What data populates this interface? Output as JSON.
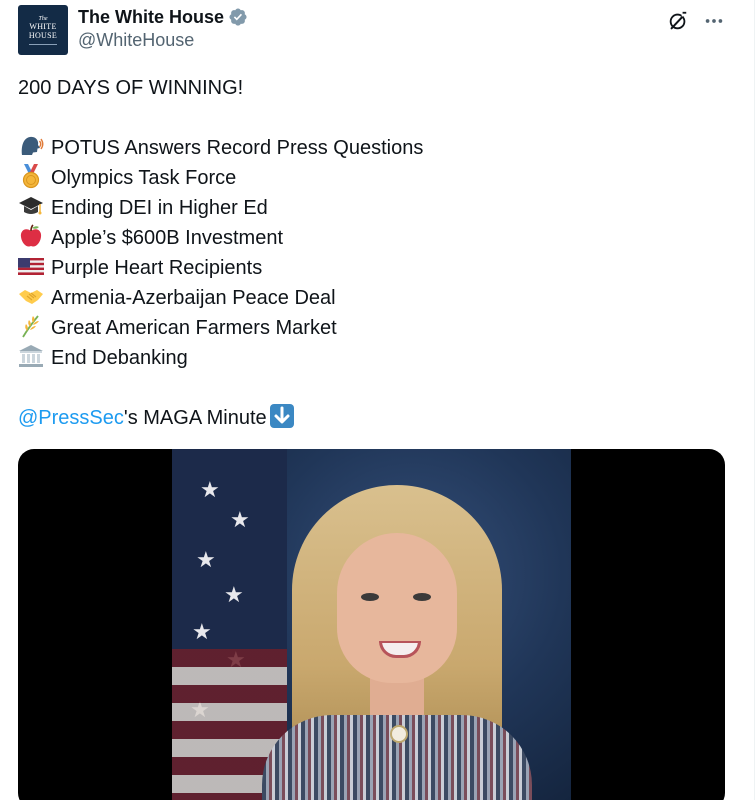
{
  "author": {
    "display_name": "The White House",
    "handle": "@WhiteHouse",
    "avatar": {
      "line1": "The",
      "line2": "WHITE",
      "line3": "HOUSE"
    },
    "verified_icon": "verified-badge-icon",
    "verified_color": "#829aab"
  },
  "top_actions": {
    "grok_icon": "grok-icon",
    "more_icon": "more-options-icon"
  },
  "tweet": {
    "headline": "200 DAYS OF WINNING!",
    "items": [
      {
        "icon": "speaking-head-icon",
        "text": "POTUS Answers Record Press Questions"
      },
      {
        "icon": "medal-icon",
        "text": "Olympics Task Force"
      },
      {
        "icon": "graduation-cap-icon",
        "text": "Ending DEI in Higher Ed"
      },
      {
        "icon": "red-apple-icon",
        "text": "Apple’s $600B Investment"
      },
      {
        "icon": "us-flag-icon",
        "text": "Purple Heart Recipients"
      },
      {
        "icon": "handshake-icon",
        "text": "Armenia-Azerbaijan Peace Deal"
      },
      {
        "icon": "sheaf-of-rice-icon",
        "text": "Great American Farmers Market"
      },
      {
        "icon": "classical-building-icon",
        "text": "End Debanking"
      }
    ],
    "mention": "@PressSec",
    "mention_suffix": "'s MAGA Minute",
    "arrow_icon": "down-arrow-icon"
  },
  "colors": {
    "link": "#1d9bf0",
    "text": "#0f1419",
    "secondary": "#536471",
    "avatar_bg": "#132b46"
  },
  "media": {
    "type": "video"
  }
}
